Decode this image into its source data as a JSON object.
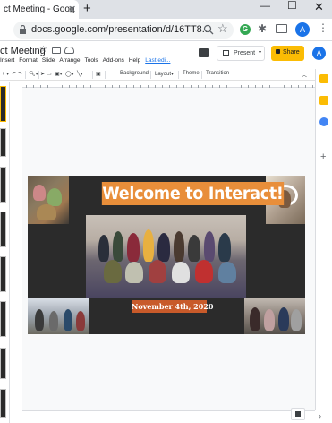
{
  "browser": {
    "tab_title": "ct Meeting - Goog",
    "tab_close": "✕",
    "new_tab": "+",
    "url": "docs.google.com/presentation/d/16TT8...",
    "window_min": "—",
    "window_max": "☐",
    "window_close": "✕",
    "profile_initial": "A",
    "extension_label": "G"
  },
  "doc": {
    "title": "ct Meeting",
    "menu": [
      "Insert",
      "Format",
      "Slide",
      "Arrange",
      "Tools",
      "Add-ons",
      "Help"
    ],
    "last_edit": "Last edi...",
    "present_label": "Present",
    "share_label": "Share",
    "avatar_initial": "A"
  },
  "toolbar": {
    "background_label": "Background",
    "layout_label": "Layout▾",
    "theme_label": "Theme",
    "transition_label": "Transition"
  },
  "slide": {
    "title": "Welcome to Interact!",
    "date": "November 4th, 2020"
  }
}
